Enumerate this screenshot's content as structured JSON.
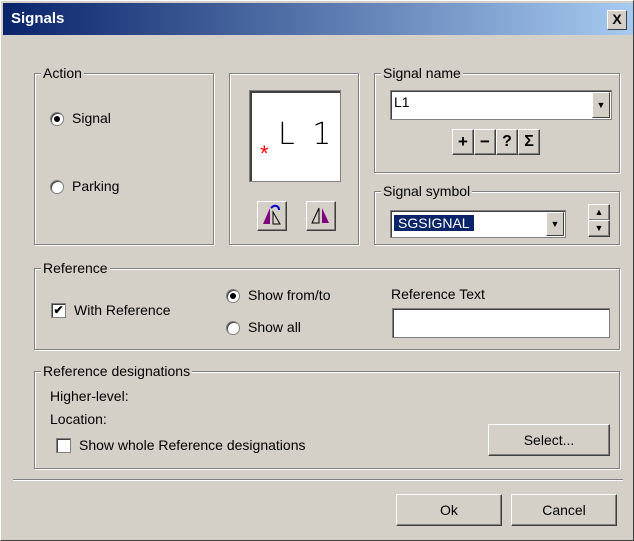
{
  "window": {
    "title": "Signals",
    "close_glyph": "X"
  },
  "action": {
    "legend": "Action",
    "options": [
      {
        "label": "Signal",
        "checked": true
      },
      {
        "label": "Parking",
        "checked": false
      }
    ],
    "preview_text": "L 1",
    "preview_marker": "*",
    "rotate_icon": "rotate-mirror-icon",
    "mirror_icon": "mirror-icon"
  },
  "signal_name": {
    "legend": "Signal name",
    "value": "L1",
    "buttons": [
      "+",
      "−",
      "?",
      "Σ"
    ]
  },
  "signal_symbol": {
    "legend": "Signal symbol",
    "value": "SGSIGNAL"
  },
  "reference": {
    "legend": "Reference",
    "with_reference": {
      "label": "With Reference",
      "checked": true
    },
    "show_options": [
      {
        "label": "Show from/to",
        "checked": true
      },
      {
        "label": "Show all",
        "checked": false
      }
    ],
    "text_label": "Reference Text",
    "text_value": ""
  },
  "designations": {
    "legend": "Reference designations",
    "higher_level": "Higher-level:",
    "location": "Location:",
    "show_whole": {
      "label": "Show whole Reference designations",
      "checked": false
    },
    "select_label": "Select..."
  },
  "footer": {
    "ok_label": "Ok",
    "cancel_label": "Cancel"
  }
}
